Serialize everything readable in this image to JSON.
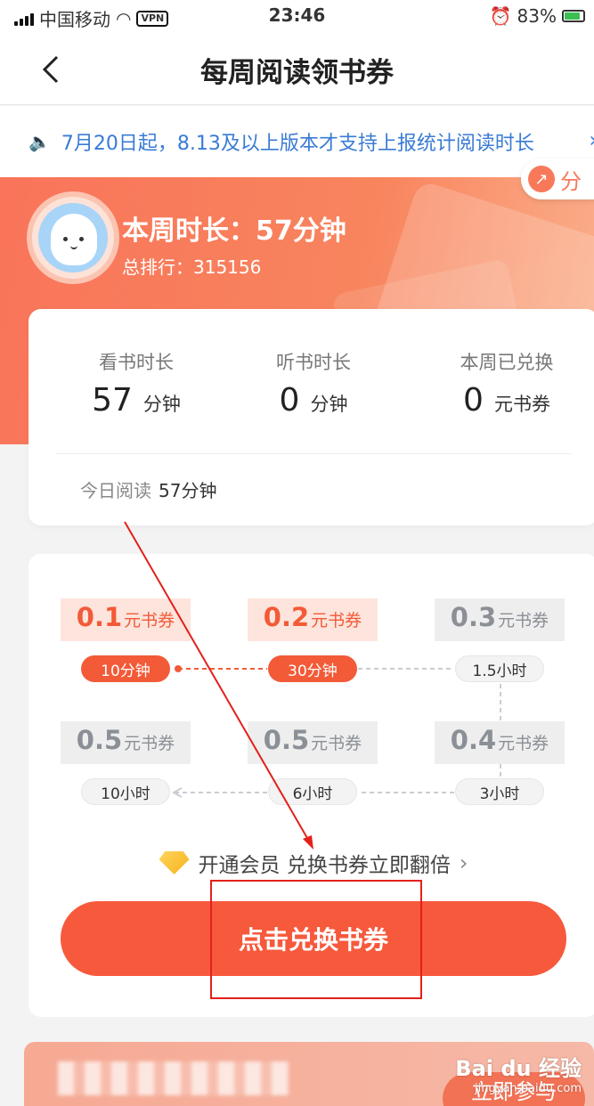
{
  "status_bar": {
    "carrier": "中国移动",
    "vpn": "VPN",
    "time": "23:46",
    "battery": "83%",
    "battery_level": 0.83
  },
  "nav": {
    "back_icon": "chevron-left-icon",
    "title": "每周阅读领书券"
  },
  "notice": {
    "text": "7月20日起，8.13及以上版本才支持上报统计阅读时长"
  },
  "share": {
    "label": "分"
  },
  "profile": {
    "weekly_label": "本周时长：",
    "weekly_value": "57分钟",
    "rank_label": "总排行：",
    "rank_value": "315156"
  },
  "stats": [
    {
      "label": "看书时长",
      "value": "57",
      "unit": "分钟"
    },
    {
      "label": "听书时长",
      "value": "0",
      "unit": "分钟"
    },
    {
      "label": "本周已兑换",
      "value": "0",
      "unit": "元书券"
    }
  ],
  "today": {
    "label": "今日阅读",
    "value": "57分钟"
  },
  "tiers": [
    {
      "amount": "0.1",
      "unit": "元书券",
      "time": "10分钟",
      "active": true
    },
    {
      "amount": "0.2",
      "unit": "元书券",
      "time": "30分钟",
      "active": true
    },
    {
      "amount": "0.3",
      "unit": "元书券",
      "time": "1.5小时",
      "active": false
    },
    {
      "amount": "0.4",
      "unit": "元书券",
      "time": "3小时",
      "active": false
    },
    {
      "amount": "0.5",
      "unit": "元书券",
      "time": "6小时",
      "active": false
    },
    {
      "amount": "0.5",
      "unit": "元书券",
      "time": "10小时",
      "active": false
    }
  ],
  "vip": {
    "text": "开通会员 兑换书券立即翻倍"
  },
  "cta": {
    "label": "点击兑换书券"
  },
  "bottom": {
    "button": "立即参与"
  },
  "watermark": {
    "brand": "Bai du 经验",
    "url": "jingyan.baidu.com"
  },
  "colors": {
    "accent": "#f7593c",
    "banner": "#f9745a",
    "notice": "#3a7bd5",
    "annotation": "#e3201b"
  }
}
